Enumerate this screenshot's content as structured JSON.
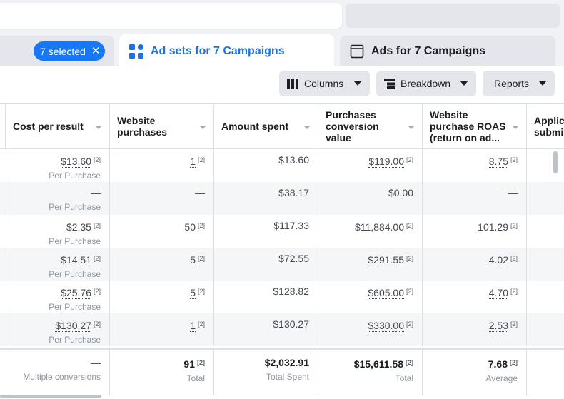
{
  "colors": {
    "accent": "#1877f2",
    "tab_active_text": "#1b74e4"
  },
  "filters": {
    "selected_label": "7 selected",
    "clear_icon": "close-icon"
  },
  "tabs": [
    {
      "label": "Ad sets for 7 Campaigns",
      "icon": "grid-icon",
      "active": true
    },
    {
      "label": "Ads for 7 Campaigns",
      "icon": "ad-window-icon",
      "active": false
    }
  ],
  "toolbar": {
    "columns_label": "Columns",
    "breakdown_label": "Breakdown",
    "reports_label": "Reports"
  },
  "table": {
    "headers": [
      "Cost per result",
      "Website purchases",
      "Amount spent",
      "Purchases conversion value",
      "Website purchase ROAS (return on ad...",
      "Applic submi"
    ],
    "header_lines": [
      [
        "Cost per result"
      ],
      [
        "Website",
        "purchases"
      ],
      [
        "Amount spent"
      ],
      [
        "Purchases",
        "conversion value"
      ],
      [
        "Website",
        "purchase ROAS",
        "(return on ad..."
      ],
      [
        "Applic",
        "submi"
      ]
    ],
    "rows": [
      {
        "cost": "$13.60",
        "cost_sub": "Per Purchase",
        "purchases": "1",
        "spent": "$13.60",
        "value": "$119.00",
        "roas": "8.75"
      },
      {
        "cost": "—",
        "cost_sub": "Per Purchase",
        "purchases": "—",
        "spent": "$38.17",
        "value": "$0.00",
        "roas": "—"
      },
      {
        "cost": "$2.35",
        "cost_sub": "Per Purchase",
        "purchases": "50",
        "spent": "$117.33",
        "value": "$11,884.00",
        "roas": "101.29"
      },
      {
        "cost": "$14.51",
        "cost_sub": "Per Purchase",
        "purchases": "5",
        "spent": "$72.55",
        "value": "$291.55",
        "roas": "4.02"
      },
      {
        "cost": "$25.76",
        "cost_sub": "Per Purchase",
        "purchases": "5",
        "spent": "$128.82",
        "value": "$605.00",
        "roas": "4.70"
      },
      {
        "cost": "$130.27",
        "cost_sub": "Per Purchase",
        "purchases": "1",
        "spent": "$130.27",
        "value": "$330.00",
        "roas": "2.53"
      }
    ],
    "footnote_marker": "[2]",
    "summary": {
      "cost": "—",
      "cost_sub": "Multiple conversions",
      "purchases": "91",
      "purchases_sub": "Total",
      "spent": "$2,032.91",
      "spent_sub": "Total Spent",
      "value": "$15,611.58",
      "value_sub": "Total",
      "roas": "7.68",
      "roas_sub": "Average"
    }
  }
}
